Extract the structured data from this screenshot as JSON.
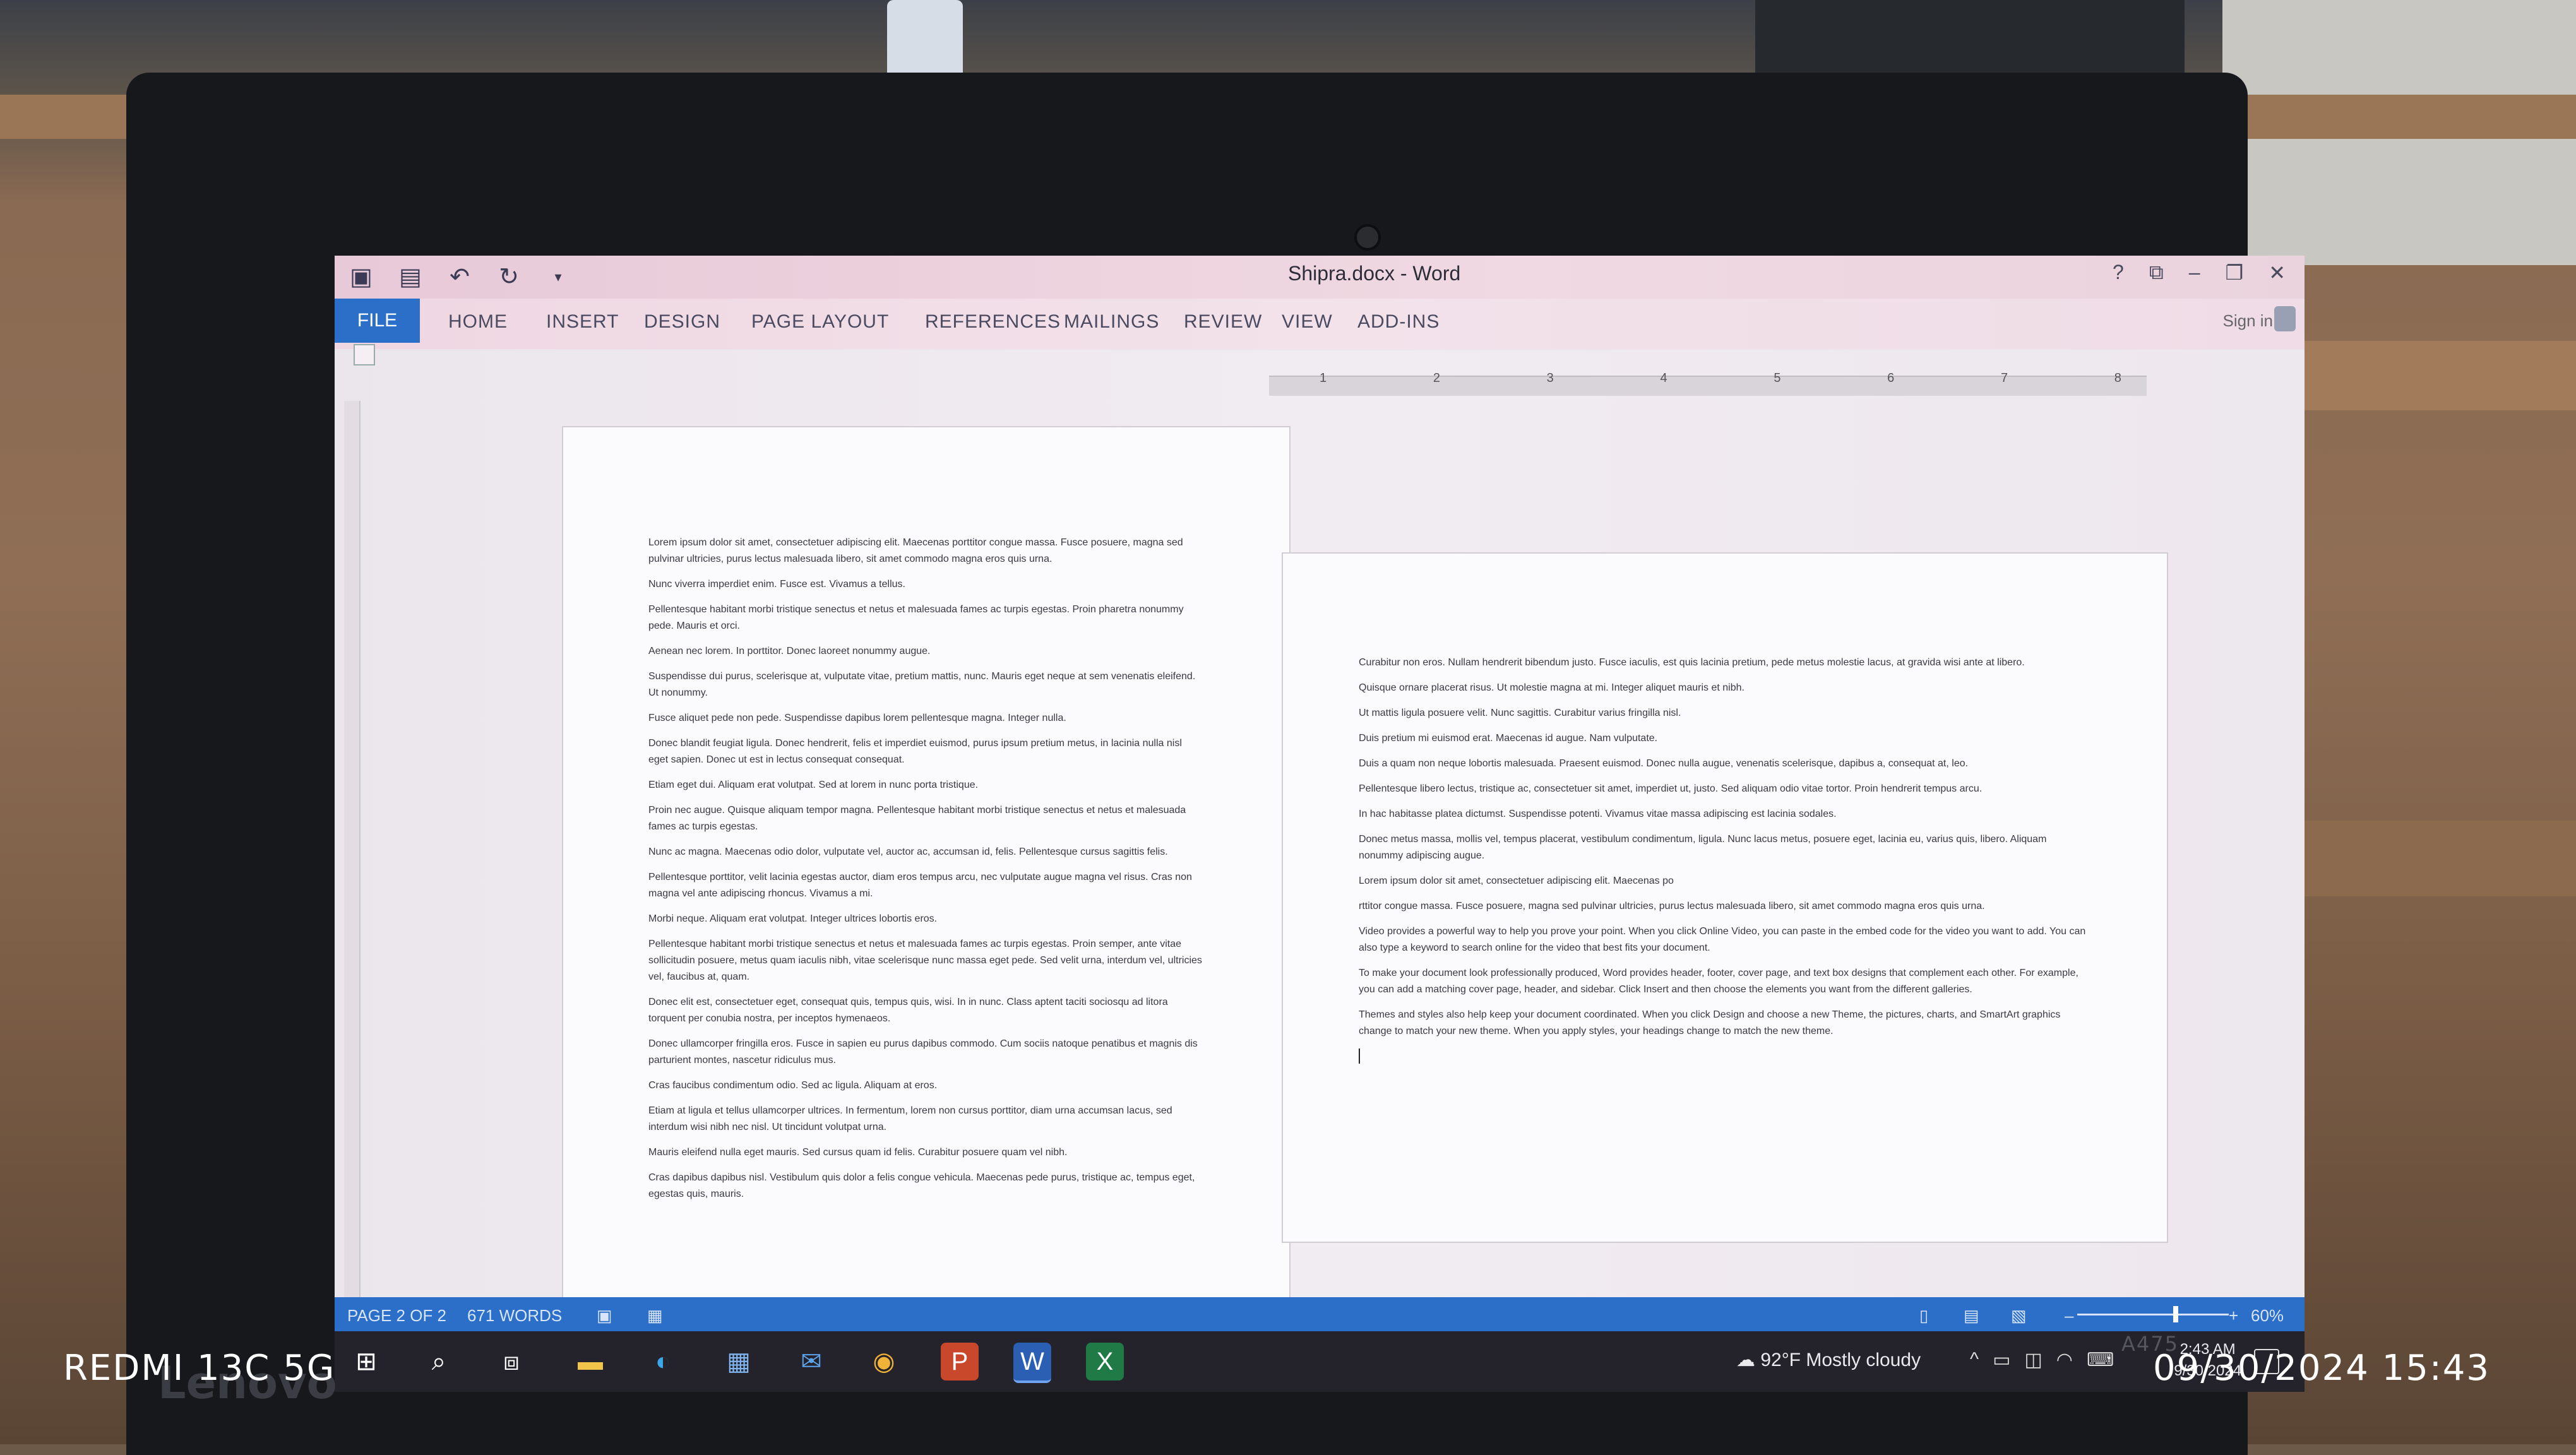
{
  "window": {
    "title": "Shipra.docx - Word"
  },
  "ribbon": {
    "tabs": [
      "FILE",
      "HOME",
      "INSERT",
      "DESIGN",
      "PAGE LAYOUT",
      "REFERENCES",
      "MAILINGS",
      "REVIEW",
      "VIEW",
      "ADD-INS"
    ],
    "sign_in": "Sign in"
  },
  "ruler": {
    "numbers": [
      "1",
      "2",
      "3",
      "4",
      "5",
      "6",
      "7",
      "8"
    ]
  },
  "page1": {
    "paragraphs": [
      "Lorem ipsum dolor sit amet, consectetuer adipiscing elit. Maecenas porttitor congue massa. Fusce posuere, magna sed pulvinar ultricies, purus lectus malesuada libero, sit amet commodo magna eros quis urna.",
      "Nunc viverra imperdiet enim. Fusce est. Vivamus a tellus.",
      "Pellentesque habitant morbi tristique senectus et netus et malesuada fames ac turpis egestas. Proin pharetra nonummy pede. Mauris et orci.",
      "Aenean nec lorem. In porttitor. Donec laoreet nonummy augue.",
      "Suspendisse dui purus, scelerisque at, vulputate vitae, pretium mattis, nunc. Mauris eget neque at sem venenatis eleifend. Ut nonummy.",
      "Fusce aliquet pede non pede. Suspendisse dapibus lorem pellentesque magna. Integer nulla.",
      "Donec blandit feugiat ligula. Donec hendrerit, felis et imperdiet euismod, purus ipsum pretium metus, in lacinia nulla nisl eget sapien. Donec ut est in lectus consequat consequat.",
      "Etiam eget dui. Aliquam erat volutpat. Sed at lorem in nunc porta tristique.",
      "Proin nec augue. Quisque aliquam tempor magna. Pellentesque habitant morbi tristique senectus et netus et malesuada fames ac turpis egestas.",
      "Nunc ac magna. Maecenas odio dolor, vulputate vel, auctor ac, accumsan id, felis. Pellentesque cursus sagittis felis.",
      "Pellentesque porttitor, velit lacinia egestas auctor, diam eros tempus arcu, nec vulputate augue magna vel risus. Cras non magna vel ante adipiscing rhoncus. Vivamus a mi.",
      "Morbi neque. Aliquam erat volutpat. Integer ultrices lobortis eros.",
      "Pellentesque habitant morbi tristique senectus et netus et malesuada fames ac turpis egestas. Proin semper, ante vitae sollicitudin posuere, metus quam iaculis nibh, vitae scelerisque nunc massa eget pede. Sed velit urna, interdum vel, ultricies vel, faucibus at, quam.",
      "Donec elit est, consectetuer eget, consequat quis, tempus quis, wisi. In in nunc. Class aptent taciti sociosqu ad litora torquent per conubia nostra, per inceptos hymenaeos.",
      "Donec ullamcorper fringilla eros. Fusce in sapien eu purus dapibus commodo. Cum sociis natoque penatibus et magnis dis parturient montes, nascetur ridiculus mus.",
      "Cras faucibus condimentum odio. Sed ac ligula. Aliquam at eros.",
      "Etiam at ligula et tellus ullamcorper ultrices. In fermentum, lorem non cursus porttitor, diam urna accumsan lacus, sed interdum wisi nibh nec nisl. Ut tincidunt volutpat urna.",
      "Mauris eleifend nulla eget mauris. Sed cursus quam id felis. Curabitur posuere quam vel nibh.",
      "Cras dapibus dapibus nisl. Vestibulum quis dolor a felis congue vehicula. Maecenas pede purus, tristique ac, tempus eget, egestas quis, mauris."
    ]
  },
  "page2": {
    "paragraphs": [
      "Curabitur non eros. Nullam hendrerit bibendum justo. Fusce iaculis, est quis lacinia pretium, pede metus molestie lacus, at gravida wisi ante at libero.",
      "Quisque ornare placerat risus. Ut molestie magna at mi. Integer aliquet mauris et nibh.",
      "Ut mattis ligula posuere velit. Nunc sagittis. Curabitur varius fringilla nisl.",
      "Duis pretium mi euismod erat. Maecenas id augue. Nam vulputate.",
      "Duis a quam non neque lobortis malesuada. Praesent euismod. Donec nulla augue, venenatis scelerisque, dapibus a, consequat at, leo.",
      "Pellentesque libero lectus, tristique ac, consectetuer sit amet, imperdiet ut, justo. Sed aliquam odio vitae tortor. Proin hendrerit tempus arcu.",
      "In hac habitasse platea dictumst. Suspendisse potenti. Vivamus vitae massa adipiscing est lacinia sodales.",
      "Donec metus massa, mollis vel, tempus placerat, vestibulum condimentum, ligula. Nunc lacus metus, posuere eget, lacinia eu, varius quis, libero. Aliquam nonummy adipiscing augue.",
      "Lorem ipsum dolor sit amet, consectetuer adipiscing elit. Maecenas po",
      "rttitor congue massa. Fusce posuere, magna sed pulvinar ultricies, purus lectus malesuada libero, sit amet commodo magna eros quis urna.",
      "Video provides a powerful way to help you prove your point. When you click Online Video, you can paste in the embed code for the video you want to add. You can also type a keyword to search online for the video that best fits your document.",
      "To make your document look professionally produced, Word provides header, footer, cover page, and text box designs that complement each other. For example, you can add a matching cover page, header, and sidebar. Click Insert and then choose the elements you want from the different galleries.",
      "Themes and styles also help keep your document coordinated. When you click Design and choose a new Theme, the pictures, charts, and SmartArt graphics change to match your new theme. When you apply styles, your headings change to match the new theme."
    ]
  },
  "status": {
    "page": "PAGE 2 OF 2",
    "words": "671 WORDS",
    "zoom": "60%"
  },
  "taskbar": {
    "weather": "92°F  Mostly cloudy",
    "time": "2:43 AM",
    "date": "9/30/2024"
  },
  "photo": {
    "device": "REDMI 13C 5G",
    "timestamp": "09/30/2024  15:43",
    "laptop_brand": "Lenovo",
    "model": "A475"
  },
  "colors": {
    "accent": "#2b6fc8",
    "taskbar": "#24232b"
  }
}
